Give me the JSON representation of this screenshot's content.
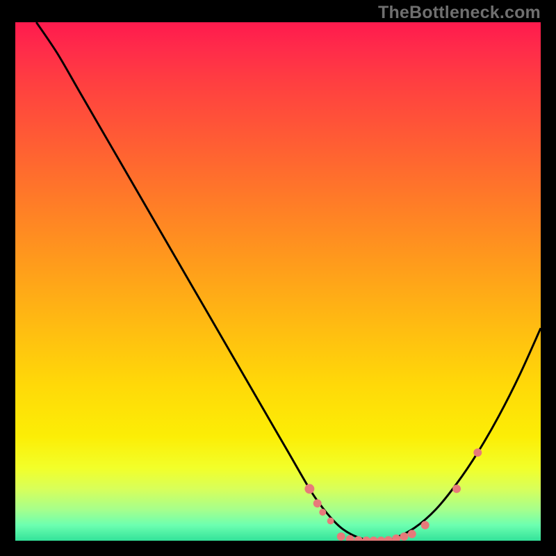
{
  "watermark": "TheBottleneck.com",
  "chart_data": {
    "type": "line",
    "title": "",
    "xlabel": "",
    "ylabel": "",
    "xlim": [
      0,
      100
    ],
    "ylim": [
      0,
      100
    ],
    "grid": false,
    "background_gradient": {
      "top": "#ff1a4d",
      "bottom": "#33e29a",
      "stops": [
        "#ff1a4d",
        "#ff7a28",
        "#ffd908",
        "#f2ff2a",
        "#33e29a"
      ]
    },
    "series": [
      {
        "name": "bottleneck-curve",
        "color": "#000000",
        "x": [
          4,
          8,
          12,
          16,
          20,
          24,
          28,
          32,
          36,
          40,
          44,
          48,
          52,
          56,
          58,
          60,
          62,
          64,
          66,
          68,
          70,
          72,
          76,
          80,
          84,
          88,
          92,
          96,
          100
        ],
        "y": [
          100,
          94,
          87,
          80,
          73,
          66,
          59,
          52,
          45,
          38,
          31,
          24,
          17,
          10,
          7,
          4.5,
          2.5,
          1.2,
          0.4,
          0,
          0,
          0.4,
          2.5,
          6,
          11,
          17,
          24,
          32,
          41
        ]
      }
    ],
    "points": [
      {
        "name": "marker-1",
        "x": 56,
        "y": 10,
        "r": 7
      },
      {
        "name": "marker-2",
        "x": 57.5,
        "y": 7.2,
        "r": 6
      },
      {
        "name": "marker-3",
        "x": 58.5,
        "y": 5.5,
        "r": 5
      },
      {
        "name": "marker-4",
        "x": 60,
        "y": 3.8,
        "r": 5
      },
      {
        "name": "marker-5",
        "x": 62,
        "y": 0.8,
        "r": 6
      },
      {
        "name": "marker-6",
        "x": 63.7,
        "y": 0.3,
        "r": 6
      },
      {
        "name": "marker-7",
        "x": 65.3,
        "y": 0.1,
        "r": 6
      },
      {
        "name": "marker-8",
        "x": 66.8,
        "y": 0,
        "r": 6
      },
      {
        "name": "marker-9",
        "x": 68.2,
        "y": 0,
        "r": 6
      },
      {
        "name": "marker-10",
        "x": 69.6,
        "y": 0,
        "r": 6
      },
      {
        "name": "marker-11",
        "x": 71,
        "y": 0.1,
        "r": 6
      },
      {
        "name": "marker-12",
        "x": 72.5,
        "y": 0.4,
        "r": 6
      },
      {
        "name": "marker-13",
        "x": 74,
        "y": 0.8,
        "r": 6
      },
      {
        "name": "marker-14",
        "x": 75.5,
        "y": 1.3,
        "r": 6
      },
      {
        "name": "marker-15",
        "x": 78,
        "y": 3,
        "r": 6
      },
      {
        "name": "marker-16",
        "x": 84,
        "y": 10,
        "r": 6
      },
      {
        "name": "marker-17",
        "x": 88,
        "y": 17,
        "r": 6
      }
    ],
    "point_color": "#e77a7a"
  }
}
